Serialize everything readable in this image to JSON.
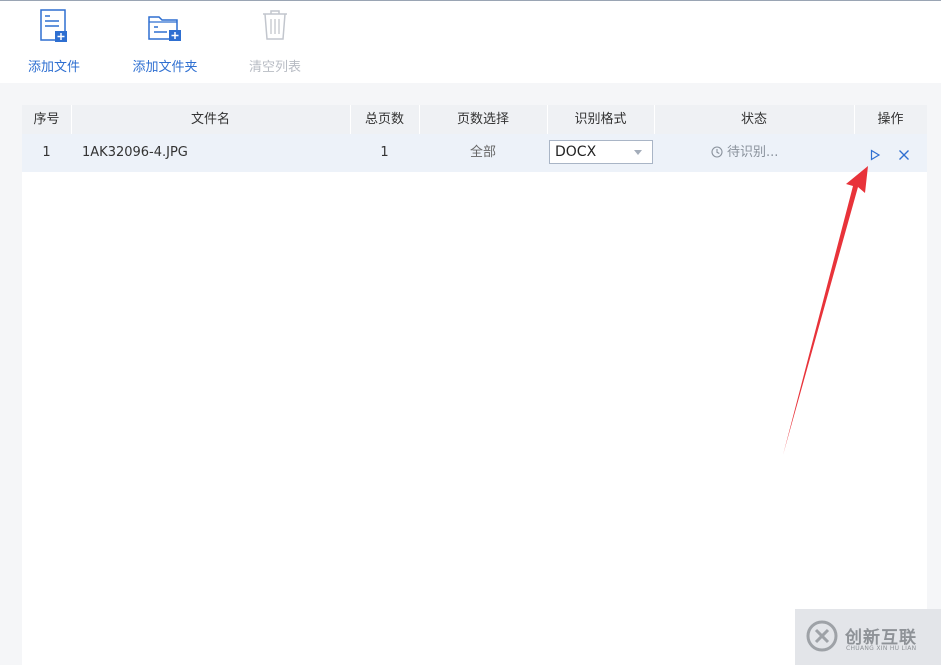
{
  "toolbar": {
    "add_file": {
      "label": "添加文件",
      "icon": "add-file-icon"
    },
    "add_folder": {
      "label": "添加文件夹",
      "icon": "add-folder-icon"
    },
    "clear_list": {
      "label": "清空列表",
      "icon": "trash-icon",
      "disabled": true
    }
  },
  "table": {
    "columns": [
      "序号",
      "文件名",
      "总页数",
      "页数选择",
      "识别格式",
      "状态",
      "操作"
    ],
    "rows": [
      {
        "index": "1",
        "filename": "1AK32096-4.JPG",
        "total_pages": "1",
        "page_selection": "全部",
        "format": "DOCX",
        "status": "待识别...",
        "actions": [
          "play-icon",
          "close-icon"
        ]
      }
    ]
  },
  "watermark": {
    "cn": "创新互联",
    "en": "CHUANG XIN HU LIAN"
  },
  "colors": {
    "accent": "#2e6fd1",
    "arrow": "#e8333a",
    "header_bg": "#eff1f4",
    "row_bg": "#edf2f9",
    "disabled": "#b8bcc4"
  }
}
